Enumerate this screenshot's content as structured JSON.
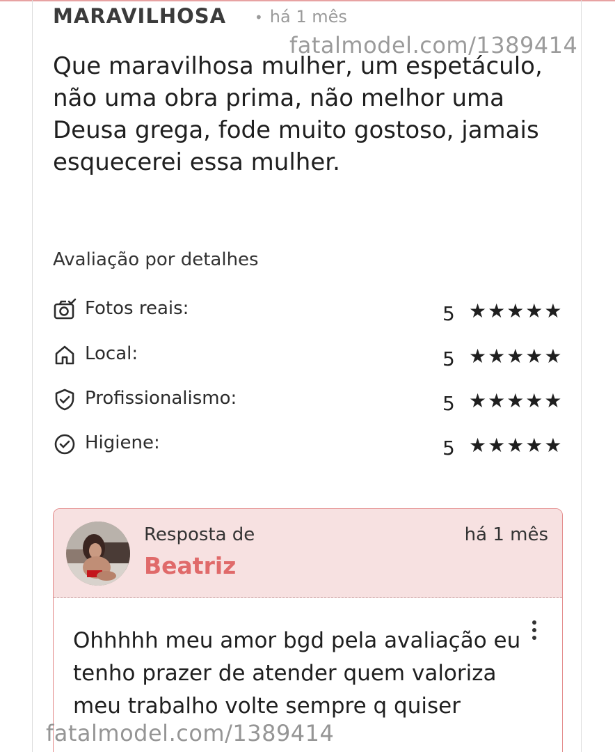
{
  "review": {
    "title": "MARAVILHOSA",
    "time": "há 1 mês",
    "body": "Que maravilhosa mulher, um espetáculo, não uma obra prima, não melhor uma Deusa grega, fode muito gostoso, jamais esquecerei essa mulher."
  },
  "watermark": {
    "top": "fatalmodel.com/1389414",
    "bottom": "fatalmodel.com/1389414"
  },
  "details": {
    "heading": "Avaliação por detalhes",
    "items": [
      {
        "label": "Fotos reais:",
        "score": "5",
        "stars": "★★★★★",
        "icon": "camera-check-icon"
      },
      {
        "label": "Local:",
        "score": "5",
        "stars": "★★★★★",
        "icon": "house-icon"
      },
      {
        "label": "Profissionalismo:",
        "score": "5",
        "stars": "★★★★★",
        "icon": "shield-check-icon"
      },
      {
        "label": "Higiene:",
        "score": "5",
        "stars": "★★★★★",
        "icon": "circle-check-icon"
      }
    ]
  },
  "reply": {
    "from_label": "Resposta de",
    "name": "Beatriz",
    "time": "há 1 mês",
    "body": "Ohhhhh meu amor bgd pela avaliação eu tenho prazer de atender quem valoriza meu trabalho volte sempre q quiser"
  },
  "colors": {
    "accent": "#e06a6a",
    "reply_bg": "#f7e1e1",
    "reply_border": "#e38b8b"
  }
}
